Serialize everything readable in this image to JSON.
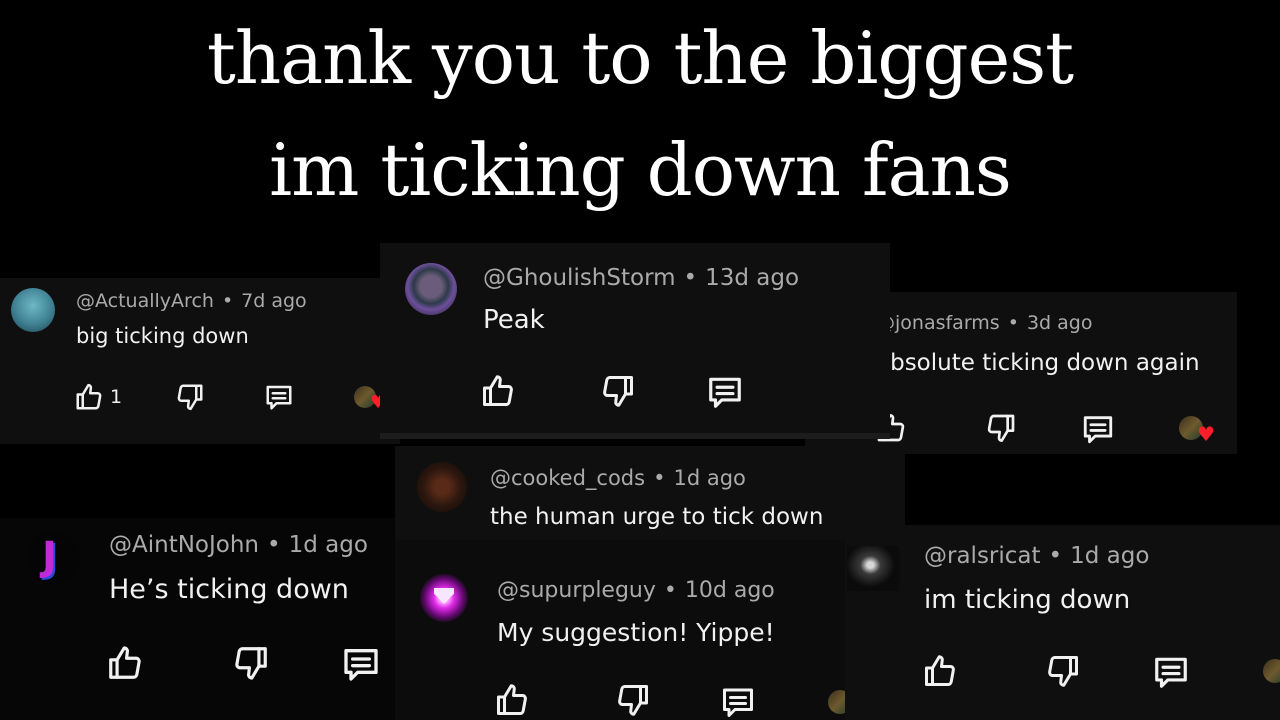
{
  "title": {
    "line1": "thank you to the biggest",
    "line2": "im ticking down fans"
  },
  "comments": {
    "arch": {
      "username": "@ActuallyArch",
      "age": "7d ago",
      "text": "big ticking down",
      "likes": "1"
    },
    "ghoulish": {
      "username": "@GhoulishStorm",
      "age": "13d ago",
      "text": "Peak"
    },
    "jonas": {
      "username": "@jonasfarms",
      "age": "3d ago",
      "text": "absolute ticking down again"
    },
    "cooked": {
      "username": "@cooked_cods",
      "age": "1d ago",
      "text": "the human urge to tick down"
    },
    "john": {
      "username": "@AintNoJohn",
      "age": "1d ago",
      "text": "He’s ticking down"
    },
    "supurple": {
      "username": "@supurpleguy",
      "age": "10d ago",
      "text": "My suggestion! Yippe!"
    },
    "ralsri": {
      "username": "@ralsricat",
      "age": "1d ago",
      "text": "im ticking down"
    }
  },
  "separator": "•",
  "colors": {
    "background": "#000000",
    "card": "#0f0f0f",
    "meta_text": "#aaaaaa",
    "body_text": "#f1f1f1",
    "heart": "#ff1e2a"
  },
  "icons": [
    "thumbs-up-icon",
    "thumbs-down-icon",
    "reply-icon",
    "creator-heart-icon"
  ]
}
